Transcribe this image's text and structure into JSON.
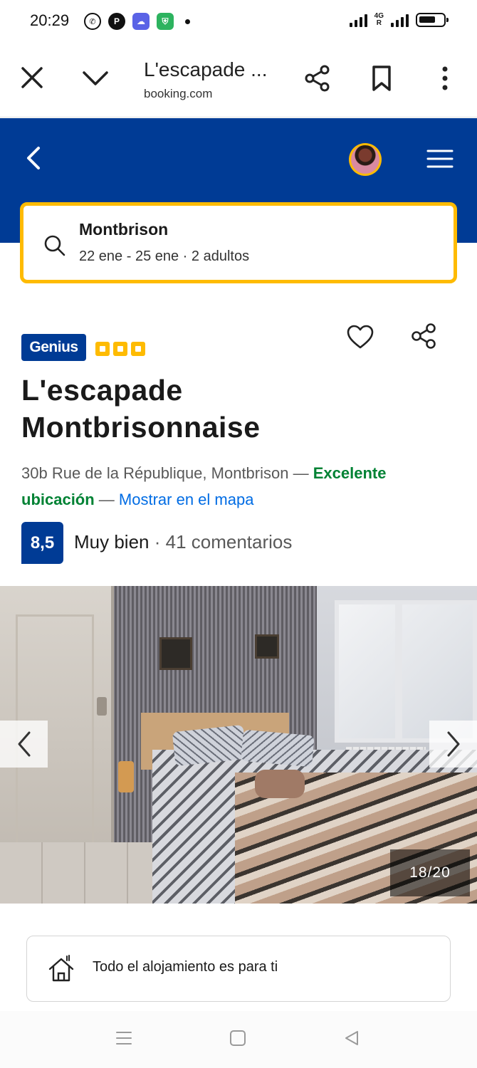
{
  "status_bar": {
    "time": "20:29",
    "network": "4G",
    "icons": [
      "whatsapp-icon",
      "p-app-icon",
      "cloud-app-icon",
      "shield-app-icon",
      "notification-dot"
    ]
  },
  "browser": {
    "page_title": "L'escapade ...",
    "domain": "booking.com"
  },
  "search": {
    "destination": "Montbrison",
    "details": "22 ene - 25 ene · 2 adultos"
  },
  "property": {
    "genius_label": "Genius",
    "rating_squares": 3,
    "title": "L'escapade Montbrisonnaise",
    "address": "30b Rue de la République, Montbrison",
    "dash": " — ",
    "location_label": "Excelente ubicación",
    "map_link": "Mostrar en el mapa",
    "score": "8,5",
    "score_word": "Muy bien",
    "score_sep": " · ",
    "reviews": "41 comentarios"
  },
  "gallery": {
    "counter": "18/20"
  },
  "info_card": {
    "text": "Todo el alojamiento es para ti"
  },
  "colors": {
    "brand_blue": "#003b95",
    "accent_yellow": "#febb02",
    "positive_green": "#008234",
    "link_blue": "#006ce4"
  }
}
